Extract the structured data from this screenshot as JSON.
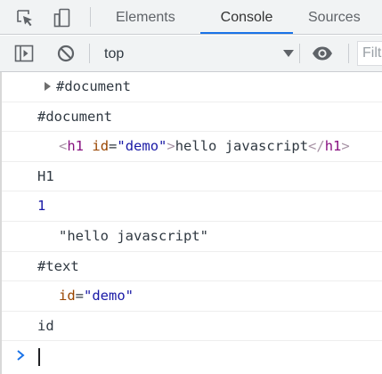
{
  "devtools": {
    "tabs": [
      {
        "label": "Elements",
        "active": false
      },
      {
        "label": "Console",
        "active": true
      },
      {
        "label": "Sources",
        "active": false
      }
    ],
    "icons": {
      "inspect": "inspect-element-icon",
      "device": "device-toolbar-icon"
    },
    "accent_color": "#1a73e8"
  },
  "console_toolbar": {
    "sidebar_icon": "show-sidebar-icon",
    "clear_icon": "clear-console-icon",
    "context": "top",
    "live_expression_icon": "eye-icon",
    "filter_placeholder": "Filter"
  },
  "console": {
    "messages": [
      {
        "kind": "node-collapsed",
        "text": "#document"
      },
      {
        "kind": "plain",
        "text": "#document"
      },
      {
        "kind": "element",
        "open_bracket": "<",
        "tag": "h1",
        "attr_name": "id",
        "attr_eq": "=",
        "attr_value": "\"demo\"",
        "close_bracket": ">",
        "inner_text": "hello javascript",
        "end_open": "</",
        "end_tag": "h1",
        "end_close": ">"
      },
      {
        "kind": "plain",
        "text": "H1"
      },
      {
        "kind": "number",
        "text": "1"
      },
      {
        "kind": "string-node",
        "text": "\"hello javascript\""
      },
      {
        "kind": "plain",
        "text": "#text"
      },
      {
        "kind": "attr-node",
        "attr_name": "id",
        "attr_eq": "=",
        "attr_value": "\"demo\""
      },
      {
        "kind": "plain",
        "text": "id"
      }
    ],
    "prompt": {
      "icon": "prompt-chevron-icon",
      "value": ""
    }
  }
}
